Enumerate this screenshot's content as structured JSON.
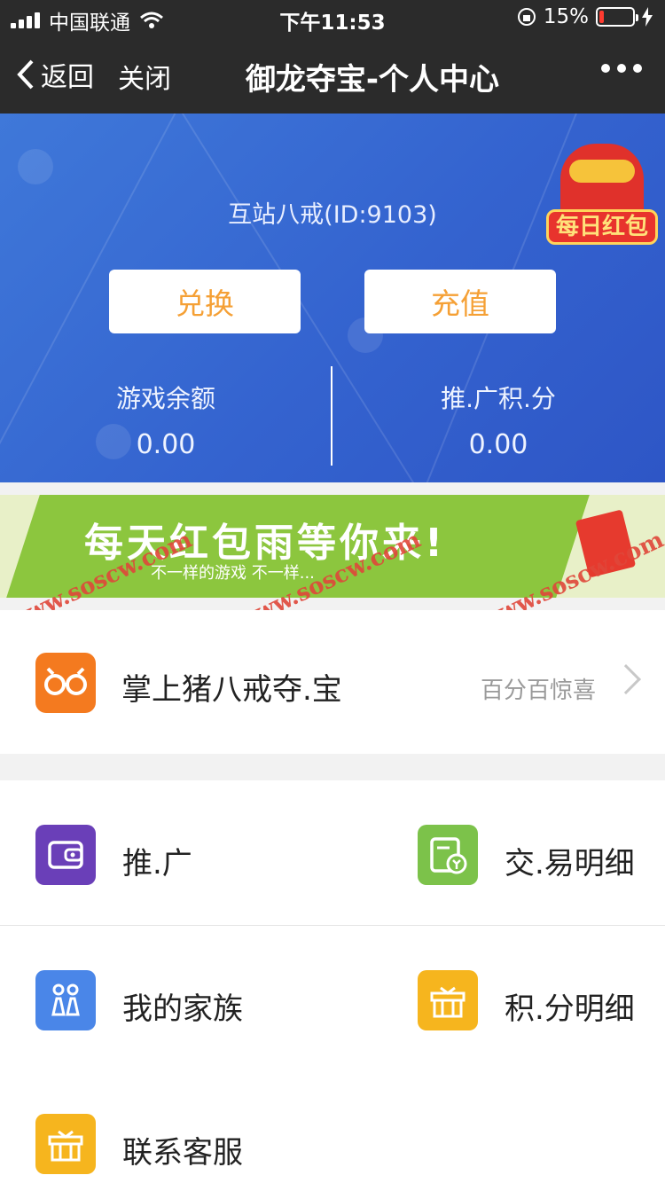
{
  "status_bar": {
    "carrier": "中国联通",
    "time": "下午11:53",
    "battery": "15%",
    "battery_level": 0.15
  },
  "nav": {
    "back_label": "返回",
    "close_label": "关闭",
    "title": "御龙夺宝-个人中心"
  },
  "hero": {
    "username": "互站八戒(ID:9103)",
    "badge_label": "每日红包",
    "exchange_label": "兑换",
    "recharge_label": "充值",
    "stats": [
      {
        "label": "游戏余额",
        "value": "0.00"
      },
      {
        "label": "推.广积.分",
        "value": "0.00"
      }
    ]
  },
  "banner": {
    "headline": "每天红包雨等你来!",
    "subline": "不一样的游戏  不一样..."
  },
  "watermark": "www.soscw.com",
  "featured": {
    "label": "掌上猪八戒夺.宝",
    "hint": "百分百惊喜"
  },
  "menu": [
    {
      "label": "推.广",
      "color": "#6a3fb8"
    },
    {
      "label": "交.易明细",
      "color": "#7cc24a"
    },
    {
      "label": "我的家族",
      "color": "#4a86e8"
    },
    {
      "label": "积.分明细",
      "color": "#f6b51e"
    },
    {
      "label": "联系客服",
      "color": "#f6b51e"
    }
  ]
}
